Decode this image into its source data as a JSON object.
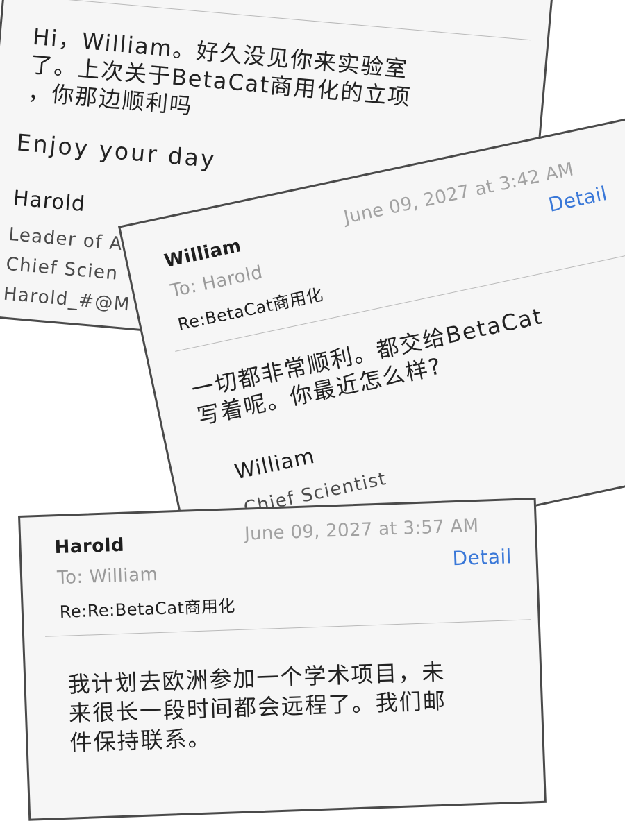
{
  "emails": [
    {
      "body": "Hi，William。好久没见你来实验室\n了。上次关于BetaCat商用化的立项\n，你那边顺利吗",
      "closing": "Enjoy your day",
      "signature": {
        "name": "Harold",
        "lines": [
          "Leader of A",
          "Chief Scien",
          "Harold_#@M"
        ]
      }
    },
    {
      "from": "William",
      "to": "To: Harold",
      "subject": "Re:BetaCat商用化",
      "date": "June 09, 2027 at 3:42 AM",
      "detail_label": "Detail",
      "body": "一切都非常顺利。都交给BetaCat\n写着呢。你最近怎么样?",
      "signature": {
        "name": "William",
        "lines": [
          "Chief Scientist"
        ]
      }
    },
    {
      "from": "Harold",
      "to": "To: William",
      "subject": "Re:Re:BetaCat商用化",
      "date": "June 09, 2027 at 3:57 AM",
      "detail_label": "Detail",
      "body": "我计划去欧洲参加一个学术项目，未\n来很长一段时间都会远程了。我们邮\n件保持联系。"
    }
  ]
}
